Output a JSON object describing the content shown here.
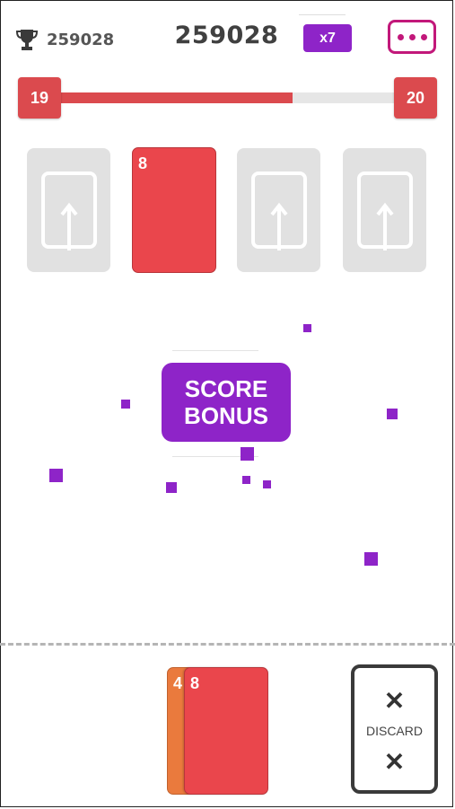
{
  "header": {
    "best_score": "259028",
    "score": "259028",
    "multiplier": "x7"
  },
  "level": {
    "current": "19",
    "next": "20",
    "progress": 0.695
  },
  "slots": [
    {
      "state": "empty",
      "icon": "upload-arrow-icon"
    },
    {
      "state": "card",
      "value": "8",
      "color": "#ea464c"
    },
    {
      "state": "empty",
      "icon": "upload-arrow-icon"
    },
    {
      "state": "empty",
      "icon": "upload-arrow-icon"
    }
  ],
  "bonus": {
    "line1": "SCORE",
    "line2": "BONUS"
  },
  "hand": {
    "back_card": {
      "value": "4",
      "color": "#ea7a3d"
    },
    "front_card": {
      "value": "8",
      "color": "#ea464c"
    }
  },
  "discard": {
    "label": "DISCARD"
  },
  "colors": {
    "accent_purple": "#8e24c8",
    "menu_magenta": "#c2187a",
    "red": "#db4a4e"
  }
}
